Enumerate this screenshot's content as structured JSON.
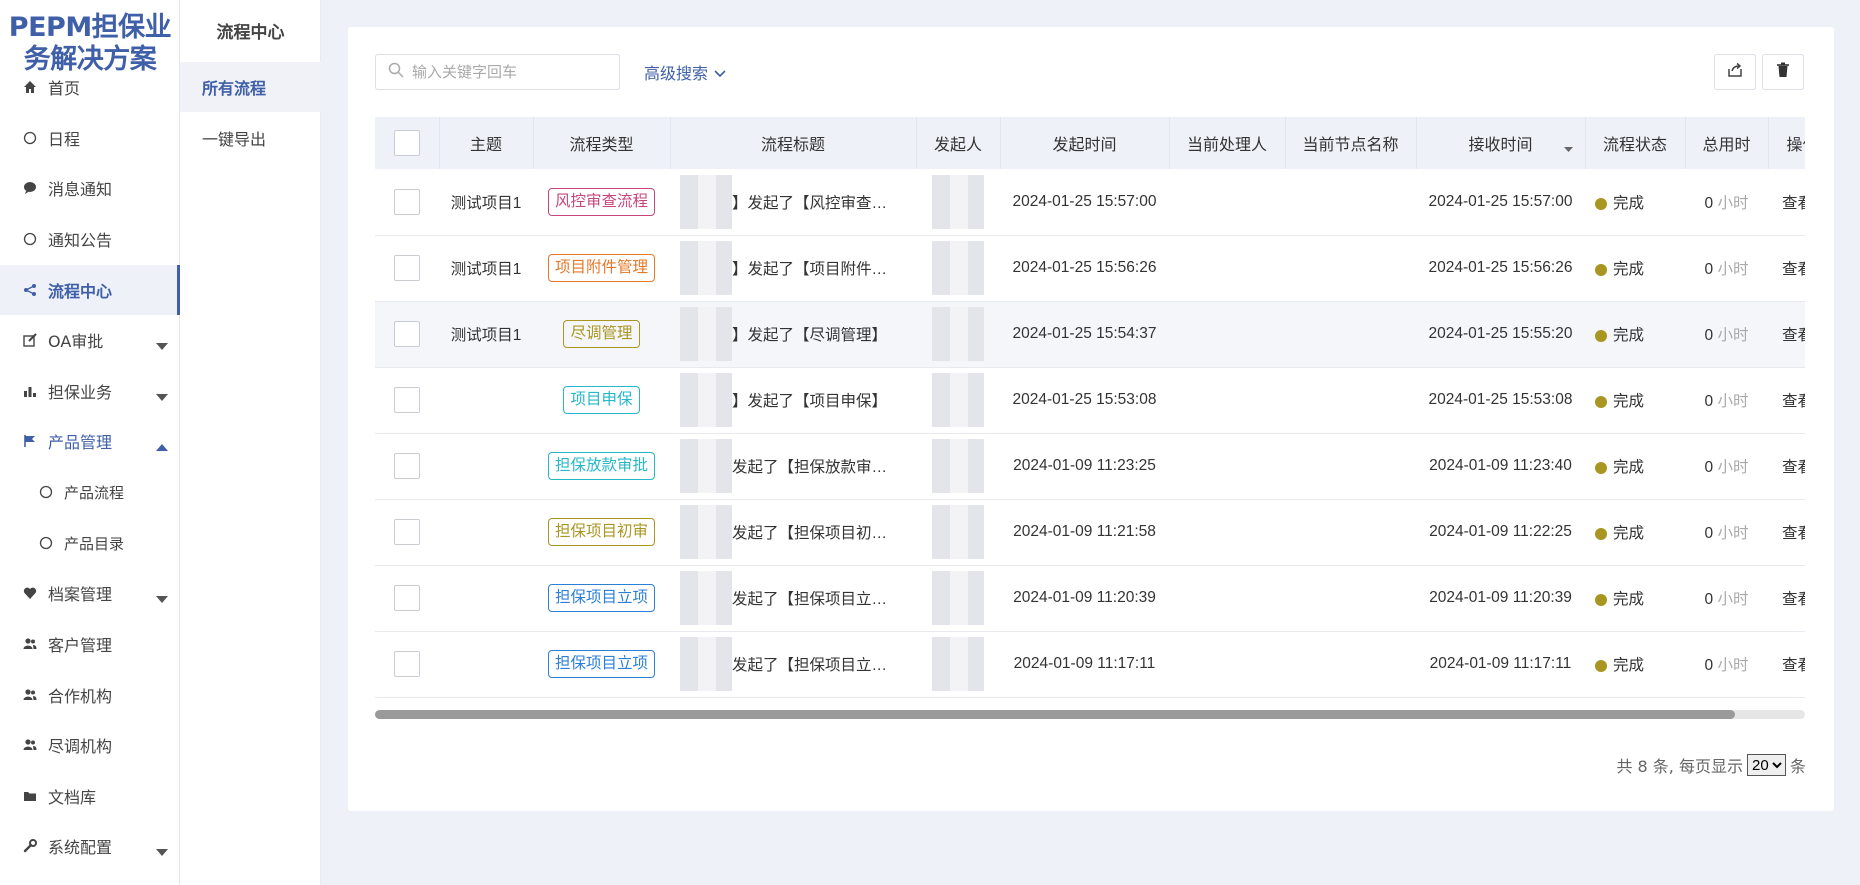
{
  "logo": {
    "line1": "PEPM担保业",
    "line2": "务解决方案"
  },
  "nav": {
    "items": [
      {
        "label": "首页"
      },
      {
        "label": "日程"
      },
      {
        "label": "消息通知"
      },
      {
        "label": "通知公告"
      },
      {
        "label": "流程中心"
      },
      {
        "label": "OA审批"
      },
      {
        "label": "担保业务"
      },
      {
        "label": "产品管理"
      },
      {
        "label": "产品流程"
      },
      {
        "label": "产品目录"
      },
      {
        "label": "档案管理"
      },
      {
        "label": "客户管理"
      },
      {
        "label": "合作机构"
      },
      {
        "label": "尽调机构"
      },
      {
        "label": "文档库"
      },
      {
        "label": "系统配置"
      }
    ]
  },
  "subnav": {
    "title": "流程中心",
    "items": [
      {
        "label": "所有流程"
      },
      {
        "label": "一键导出"
      }
    ]
  },
  "toolbar": {
    "search_placeholder": "输入关键字回车",
    "advanced_search": "高级搜索"
  },
  "table": {
    "headers": [
      "主题",
      "流程类型",
      "流程标题",
      "发起人",
      "发起时间",
      "当前处理人",
      "当前节点名称",
      "接收时间",
      "流程状态",
      "总用时",
      "操作"
    ],
    "rows": [
      {
        "subject": "测试项目1",
        "type": "风控审查流程",
        "type_color": "#c6467d",
        "title": "】发起了【风控审查…",
        "start": "2024-01-25 15:57:00",
        "handler": "",
        "node": "",
        "recv": "2024-01-25 15:57:00",
        "status": "完成",
        "hours": "0",
        "unit": "小时",
        "op": "查看"
      },
      {
        "subject": "测试项目1",
        "type": "项目附件管理",
        "type_color": "#e6782a",
        "title": "】发起了【项目附件…",
        "start": "2024-01-25 15:56:26",
        "handler": "",
        "node": "",
        "recv": "2024-01-25 15:56:26",
        "status": "完成",
        "hours": "0",
        "unit": "小时",
        "op": "查看"
      },
      {
        "subject": "测试项目1",
        "type": "尽调管理",
        "type_color": "#a99620",
        "title": "】发起了【尽调管理】",
        "start": "2024-01-25 15:54:37",
        "handler": "",
        "node": "",
        "recv": "2024-01-25 15:55:20",
        "status": "完成",
        "hours": "0",
        "unit": "小时",
        "op": "查看"
      },
      {
        "subject": "",
        "type": "项目申保",
        "type_color": "#27b7c9",
        "title": "】发起了【项目申保】",
        "start": "2024-01-25 15:53:08",
        "handler": "",
        "node": "",
        "recv": "2024-01-25 15:53:08",
        "status": "完成",
        "hours": "0",
        "unit": "小时",
        "op": "查看"
      },
      {
        "subject": "",
        "type": "担保放款审批",
        "type_color": "#27b7c9",
        "title": "发起了【担保放款审…",
        "start": "2024-01-09 11:23:25",
        "handler": "",
        "node": "",
        "recv": "2024-01-09 11:23:40",
        "status": "完成",
        "hours": "0",
        "unit": "小时",
        "op": "查看"
      },
      {
        "subject": "",
        "type": "担保项目初审",
        "type_color": "#a99620",
        "title": "发起了【担保项目初…",
        "start": "2024-01-09 11:21:58",
        "handler": "",
        "node": "",
        "recv": "2024-01-09 11:22:25",
        "status": "完成",
        "hours": "0",
        "unit": "小时",
        "op": "查看"
      },
      {
        "subject": "",
        "type": "担保项目立项",
        "type_color": "#2b7fd6",
        "title": "发起了【担保项目立…",
        "start": "2024-01-09 11:20:39",
        "handler": "",
        "node": "",
        "recv": "2024-01-09 11:20:39",
        "status": "完成",
        "hours": "0",
        "unit": "小时",
        "op": "查看"
      },
      {
        "subject": "",
        "type": "担保项目立项",
        "type_color": "#2b7fd6",
        "title": "发起了【担保项目立…",
        "start": "2024-01-09 11:17:11",
        "handler": "",
        "node": "",
        "recv": "2024-01-09 11:17:11",
        "status": "完成",
        "hours": "0",
        "unit": "小时",
        "op": "查看"
      }
    ]
  },
  "pager": {
    "total_text": "共 8 条, 每页显示",
    "page_size": "20",
    "suffix": "条"
  },
  "colors": {
    "accent": "#3f5fa8",
    "status_done": "#a99620"
  }
}
